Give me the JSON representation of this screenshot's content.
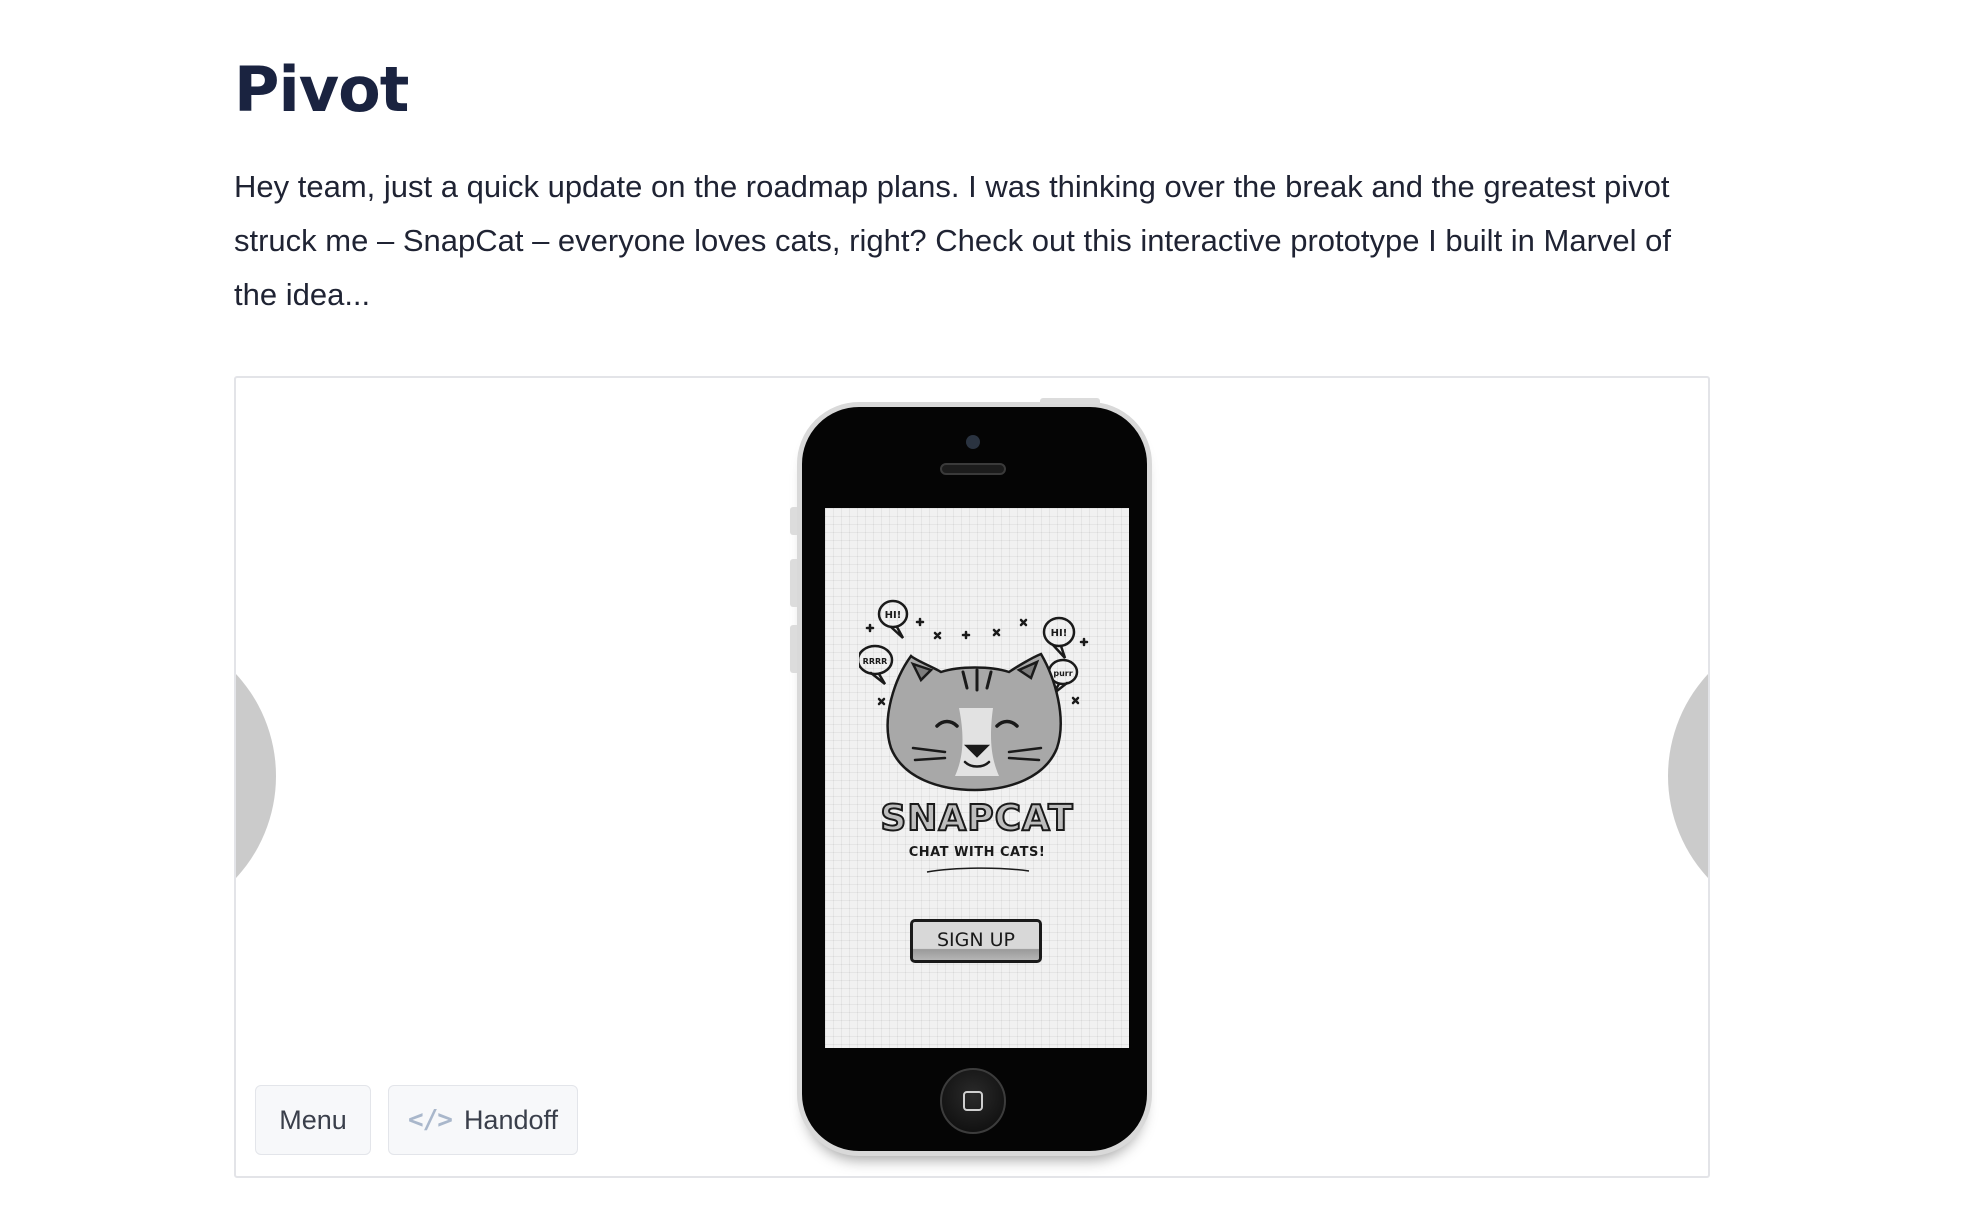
{
  "page": {
    "title": "Pivot",
    "intro": "Hey team, just a quick update on the roadmap plans. I was thinking over the break and the greatest pivot struck me – SnapCat – everyone loves cats, right? Check out this interactive prototype I built in Marvel of the idea..."
  },
  "prototype": {
    "app_name": "SNAPCAT",
    "tagline": "CHAT WITH CATS!",
    "signup_label": "SIGN UP",
    "bubbles": [
      "HI!",
      "RRRR",
      "HI!",
      "purr"
    ]
  },
  "controls": {
    "menu_label": "Menu",
    "handoff_label": "Handoff",
    "handoff_icon": "code-icon",
    "code_glyph": "</>"
  },
  "colors": {
    "title": "#1a2340",
    "text": "#1f2333",
    "embed_border": "#e3e4e8",
    "nav_blob": "#cbcbcb",
    "handoff_icon": "#a9b7cb"
  }
}
